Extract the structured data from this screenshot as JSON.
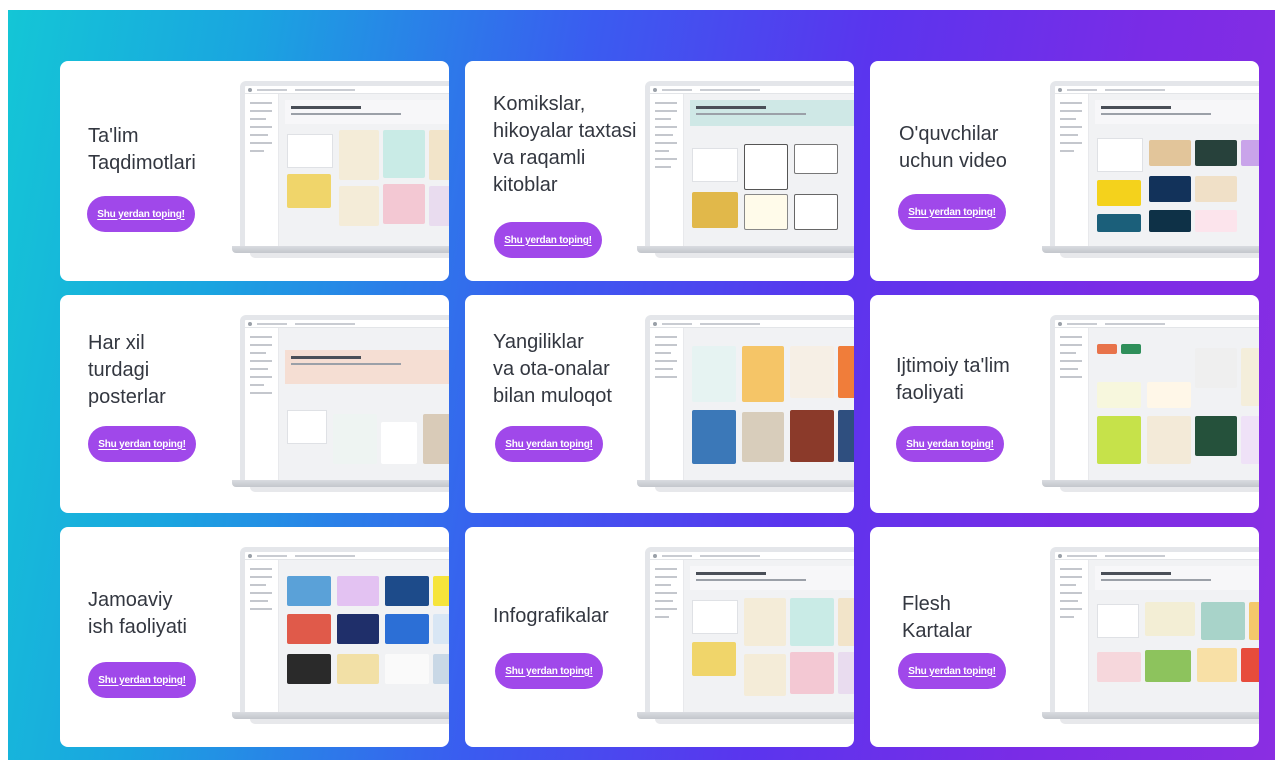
{
  "cards": [
    {
      "title": "Ta'lim\nTaqdimotlari",
      "cta": "Shu yerdan toping!"
    },
    {
      "title": "Komikslar,\nhikoyalar taxtasi\nva raqamli\nkitoblar",
      "cta": "Shu yerdan toping!"
    },
    {
      "title": "O'quvchilar\nuchun video",
      "cta": "Shu yerdan toping!"
    },
    {
      "title": "Har xil\nturdagi\nposterlar",
      "cta": "Shu yerdan toping!"
    },
    {
      "title": "Yangiliklar\nva ota-onalar\nbilan muloqot",
      "cta": "Shu yerdan toping!"
    },
    {
      "title": "Ijtimoiy ta'lim\nfaoliyati",
      "cta": "Shu yerdan toping!"
    },
    {
      "title": "Jamoaviy\nish faoliyati",
      "cta": "Shu yerdan toping!"
    },
    {
      "title": "Infografikalar",
      "cta": "Shu yerdan toping!"
    },
    {
      "title": "Flesh\nKartalar",
      "cta": "Shu yerdan toping!"
    }
  ],
  "colors": {
    "gradient_start": "#14c6d6",
    "gradient_end": "#8a2ee2",
    "cta_background": "#a048ea",
    "cta_text": "#ffffff",
    "title_text": "#333740"
  },
  "icons": [
    "laptop-mockup"
  ]
}
